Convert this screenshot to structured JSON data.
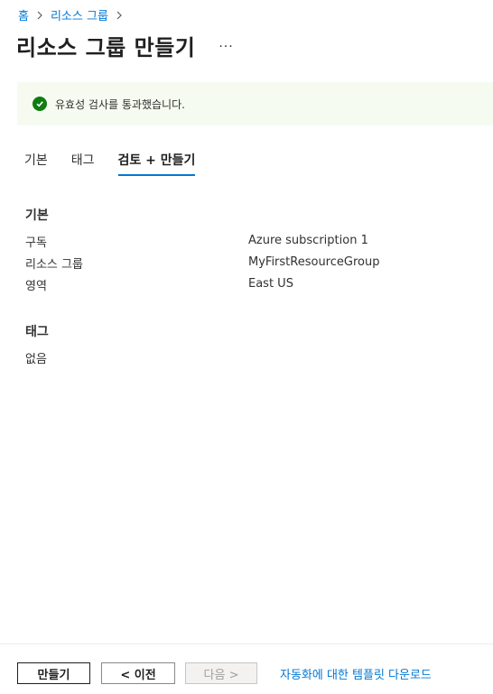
{
  "breadcrumb": {
    "home": "홈",
    "resource_groups": "리소스 그룹"
  },
  "page": {
    "title": "리소스 그룹 만들기",
    "more_label": "···"
  },
  "banner": {
    "message": "유효성 검사를 통과했습니다.",
    "status_color": "#107c10"
  },
  "tabs": [
    {
      "label": "기본"
    },
    {
      "label": "태그"
    },
    {
      "label": "검토 + 만들기"
    }
  ],
  "active_tab": "검토 + 만들기",
  "sections": {
    "basics": {
      "heading": "기본",
      "rows": [
        {
          "label": "구독",
          "value": "Azure subscription 1"
        },
        {
          "label": "리소스 그룹",
          "value": "MyFirstResourceGroup"
        },
        {
          "label": "영역",
          "value": "East US"
        }
      ]
    },
    "tags": {
      "heading": "태그",
      "empty_text": "없음"
    }
  },
  "footer": {
    "create_label": "만들기",
    "previous_label": "< 이전",
    "next_label": "다음 >",
    "download_link": "자동화에 대한 템플릿 다운로드"
  },
  "colors": {
    "accent": "#0078d4",
    "banner_bg": "#f5fbf1"
  }
}
